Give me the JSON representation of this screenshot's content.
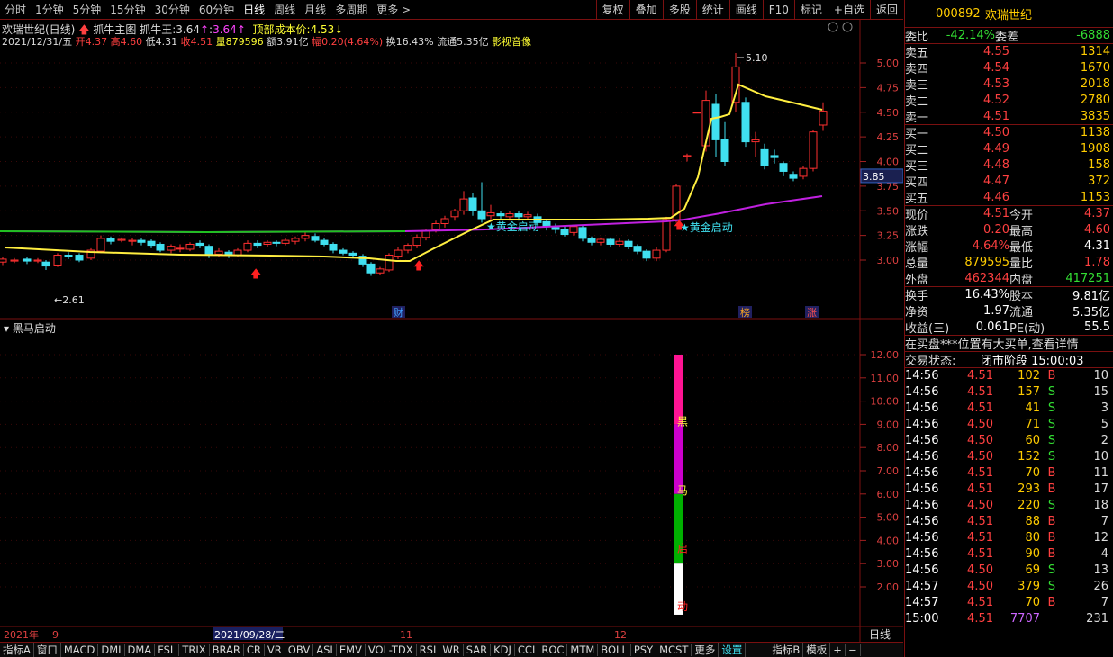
{
  "toolbar": {
    "periods": [
      "分时",
      "1分钟",
      "5分钟",
      "15分钟",
      "30分钟",
      "60分钟",
      "日线",
      "周线",
      "月线",
      "多周期",
      "更多 >"
    ],
    "actions": [
      "复权",
      "叠加",
      "多股",
      "统计",
      "画线",
      "F10",
      "标记",
      "+自选",
      "返回"
    ]
  },
  "info": {
    "title": "欢瑞世纪(日线)",
    "main_label": "抓牛主图",
    "zhuaniu_label": "抓牛王:",
    "zhuaniu_value": "3.64",
    "zhuaniu_value2": "3.64",
    "cost_label": "顶部成本价:",
    "cost_value": "4.53",
    "date": "2021/12/31/五",
    "open_label": "开",
    "open": "4.37",
    "high_label": "高",
    "high": "4.60",
    "low_label": "低",
    "low": "4.31",
    "close_label": "收",
    "close": "4.51",
    "vol_label": "量",
    "vol": "879596",
    "amt_label": "额",
    "amt": "3.91亿",
    "amp_label": "幅",
    "amp": "0.20(4.64%)",
    "turn": "换16.43%",
    "float": "流通5.35亿",
    "media": "影视音像"
  },
  "chart_data": {
    "type": "candlestick",
    "price_ticks": [
      "5.00",
      "4.75",
      "4.50",
      "4.25",
      "4.00",
      "3.75",
      "3.50",
      "3.25",
      "3.00"
    ],
    "current_price": "3.85",
    "max_label": "5.10",
    "min_label": "2.61",
    "signals": [
      "黄金启动",
      "黄金启动"
    ],
    "markers": [
      "财",
      "榜",
      "涨"
    ],
    "indicator_title": "黑马启动",
    "indicator_ticks": [
      "12.00",
      "11.00",
      "10.00",
      "9.00",
      "8.00",
      "7.00",
      "6.00",
      "5.00",
      "4.00",
      "3.00",
      "2.00"
    ],
    "indicator_text": [
      "黑",
      "马",
      "启",
      "动"
    ],
    "x_labels": [
      "2021年",
      "9",
      "2021/09/28/二",
      "11",
      "12"
    ],
    "period_label": "日线"
  },
  "quote": {
    "code": "000892",
    "name": "欢瑞世纪",
    "wb_label": "委比",
    "wb": "-42.14%",
    "wc_label": "委差",
    "wc": "-6888",
    "asks": [
      {
        "l": "卖五",
        "p": "4.55",
        "v": "1314"
      },
      {
        "l": "卖四",
        "p": "4.54",
        "v": "1670"
      },
      {
        "l": "卖三",
        "p": "4.53",
        "v": "2018"
      },
      {
        "l": "卖二",
        "p": "4.52",
        "v": "2780"
      },
      {
        "l": "卖一",
        "p": "4.51",
        "v": "3835"
      }
    ],
    "bids": [
      {
        "l": "买一",
        "p": "4.50",
        "v": "1138"
      },
      {
        "l": "买二",
        "p": "4.49",
        "v": "1908"
      },
      {
        "l": "买三",
        "p": "4.48",
        "v": "158"
      },
      {
        "l": "买四",
        "p": "4.47",
        "v": "372"
      },
      {
        "l": "买五",
        "p": "4.46",
        "v": "1153"
      }
    ],
    "stats": [
      [
        "现价",
        "4.51",
        "今开",
        "4.37"
      ],
      [
        "涨跌",
        "0.20",
        "最高",
        "4.60"
      ],
      [
        "涨幅",
        "4.64%",
        "最低",
        "4.31"
      ],
      [
        "总量",
        "879595",
        "量比",
        "1.78"
      ],
      [
        "外盘",
        "462344",
        "内盘",
        "417251"
      ]
    ],
    "stats2": [
      [
        "换手",
        "16.43%",
        "股本",
        "9.81亿"
      ],
      [
        "净资",
        "1.97",
        "流通",
        "5.35亿"
      ],
      [
        "收益(三)",
        "0.061",
        "PE(动)",
        "55.5"
      ]
    ],
    "notice": "在买盘***位置有大买单,查看详情",
    "status_label": "交易状态:",
    "status": "闭市阶段 15:00:03",
    "ticks": [
      [
        "14:56",
        "4.51",
        "102",
        "B",
        "10"
      ],
      [
        "14:56",
        "4.51",
        "157",
        "S",
        "15"
      ],
      [
        "14:56",
        "4.51",
        "41",
        "S",
        "3"
      ],
      [
        "14:56",
        "4.50",
        "71",
        "S",
        "5"
      ],
      [
        "14:56",
        "4.50",
        "60",
        "S",
        "2"
      ],
      [
        "14:56",
        "4.50",
        "152",
        "S",
        "10"
      ],
      [
        "14:56",
        "4.51",
        "70",
        "B",
        "11"
      ],
      [
        "14:56",
        "4.51",
        "293",
        "B",
        "17"
      ],
      [
        "14:56",
        "4.50",
        "220",
        "S",
        "18"
      ],
      [
        "14:56",
        "4.51",
        "88",
        "B",
        "7"
      ],
      [
        "14:56",
        "4.51",
        "80",
        "B",
        "12"
      ],
      [
        "14:56",
        "4.51",
        "90",
        "B",
        "4"
      ],
      [
        "14:56",
        "4.50",
        "69",
        "S",
        "13"
      ],
      [
        "14:57",
        "4.50",
        "379",
        "S",
        "26"
      ],
      [
        "14:57",
        "4.51",
        "70",
        "B",
        "7"
      ],
      [
        "15:00",
        "4.51",
        "7707",
        "",
        "231"
      ]
    ]
  },
  "bottom_tabs": [
    "指标A",
    "窗口",
    "MACD",
    "DMI",
    "DMA",
    "FSL",
    "TRIX",
    "BRAR",
    "CR",
    "VR",
    "OBV",
    "ASI",
    "EMV",
    "VOL-TDX",
    "RSI",
    "WR",
    "SAR",
    "KDJ",
    "CCI",
    "ROC",
    "MTM",
    "BOLL",
    "PSY",
    "MCST",
    "更多",
    "设置",
    "指标B",
    "模板",
    "+",
    "−"
  ]
}
